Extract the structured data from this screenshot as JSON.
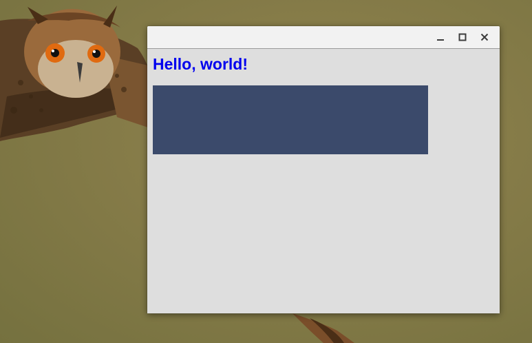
{
  "window": {
    "heading": "Hello, world!",
    "caption_buttons": [
      {
        "name": "minimize",
        "icon": "minimize-icon"
      },
      {
        "name": "maximize",
        "icon": "maximize-icon"
      },
      {
        "name": "close",
        "icon": "close-icon"
      }
    ]
  },
  "colors": {
    "heading_text": "#0000ee",
    "block_fill": "#3b4a6b",
    "window_bg": "#dedede",
    "titlebar_bg": "#f2f2f2",
    "wallpaper": "#857b48"
  },
  "wallpaper": {
    "subject": "owl-in-flight"
  }
}
